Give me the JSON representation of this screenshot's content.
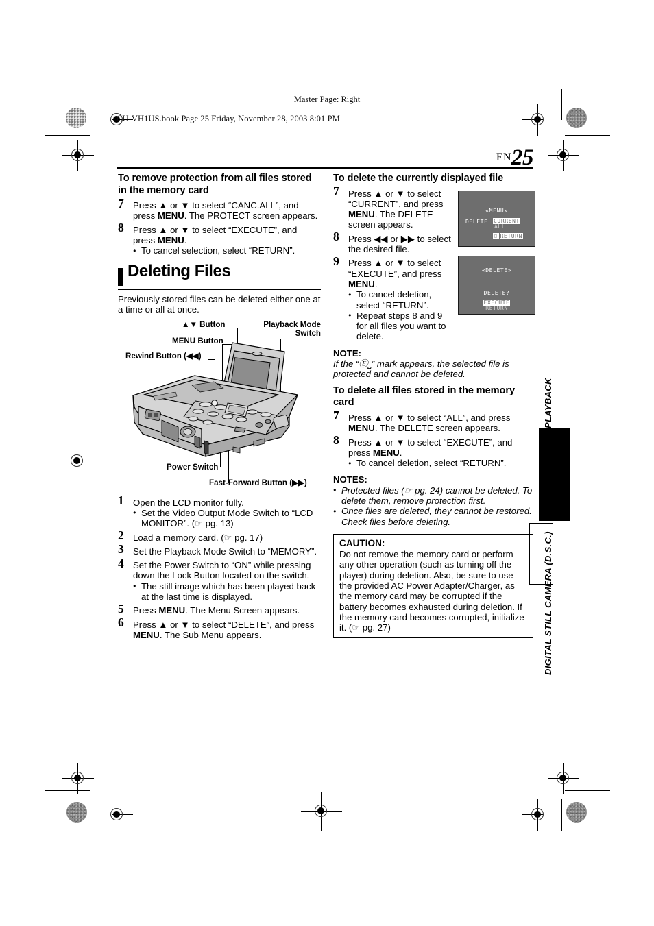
{
  "header": {
    "master_page": "Master Page: Right",
    "book_line": "CU-VH1US.book  Page 25  Friday, November 28, 2003  8:01 PM",
    "lang_code": "EN",
    "page_number": "25"
  },
  "left_column": {
    "section1_heading": "To remove protection from all files stored in the memory card",
    "steps": [
      {
        "number": "7",
        "text_parts": [
          "Press ▲ or ▼ to select “CANC.ALL”, and press ",
          "MENU",
          ". The PROTECT screen appears."
        ]
      },
      {
        "number": "8",
        "text_parts": [
          "Press ▲ or ▼ to select “EXECUTE”, and press ",
          "MENU",
          "."
        ],
        "bullets": [
          "To cancel selection, select “RETURN”."
        ]
      }
    ],
    "banner_title": "Deleting Files",
    "intro": "Previously stored files can be deleted either one at a time or all at once.",
    "callouts": {
      "updown_button": "▲▼ Button",
      "playback_mode_switch": "Playback Mode\nSwitch",
      "menu_button": "MENU Button",
      "rewind_button": "Rewind Button (◀◀)",
      "power_switch": "Power Switch",
      "fast_forward_button": "Fast-Forward Button (▶▶)"
    },
    "numbered_steps": [
      {
        "number": "1",
        "text": "Open the LCD monitor fully.",
        "bullets": [
          "Set the Video Output Mode Switch to “LCD MONITOR”. (☞ pg. 13)"
        ]
      },
      {
        "number": "2",
        "text": "Load a memory card. (☞ pg. 17)"
      },
      {
        "number": "3",
        "text": "Set the Playback Mode Switch to “MEMORY”."
      },
      {
        "number": "4",
        "text": "Set the Power Switch to “ON” while pressing down the Lock Button located on the switch.",
        "bullets": [
          "The still image which has been played back at the last time is displayed."
        ]
      },
      {
        "number": "5",
        "text_parts": [
          "Press ",
          "MENU",
          ". The Menu Screen appears."
        ]
      },
      {
        "number": "6",
        "text_parts": [
          "Press ▲ or ▼ to select “DELETE”, and press ",
          "MENU",
          ". The Sub Menu appears."
        ]
      }
    ]
  },
  "right_column": {
    "section2_heading": "To delete the currently displayed file",
    "steps": [
      {
        "number": "7",
        "text_parts": [
          "Press ▲ or ▼ to select “CURRENT”, and press ",
          "MENU",
          ". The DELETE screen appears."
        ]
      },
      {
        "number": "8",
        "text": "Press ◀◀ or ▶▶ to select the desired file."
      },
      {
        "number": "9",
        "text_parts": [
          "Press ▲ or ▼ to select “EXECUTE”, and press ",
          "MENU",
          "."
        ],
        "bullets": [
          "To cancel deletion, select “RETURN”.",
          "Repeat steps 8 and 9 for all files you want to delete."
        ]
      }
    ],
    "osd_menu": {
      "title": "«MENU»",
      "label": "DELETE",
      "option_selected": "CURRENT",
      "option_other": "ALL",
      "return": "RETURN"
    },
    "osd_delete": {
      "title": "«DELETE»",
      "prompt": "DELETE?",
      "option_selected": "EXECUTE",
      "option_other": "RETURN"
    },
    "note_heading": "NOTE:",
    "note_body": "If the “Ⓔ⎵” mark appears, the selected file is protected and cannot be deleted.",
    "section3_heading": "To delete all files stored in the memory card",
    "steps_all": [
      {
        "number": "7",
        "text_parts": [
          "Press ▲ or ▼ to select “ALL”, and press ",
          "MENU",
          ". The DELETE screen appears."
        ]
      },
      {
        "number": "8",
        "text_parts": [
          "Press ▲ or ▼ to select “EXECUTE”, and press ",
          "MENU",
          "."
        ],
        "bullets": [
          "To cancel deletion, select “RETURN”."
        ]
      }
    ],
    "notes_heading": "NOTES:",
    "notes": [
      "Protected files (☞ pg. 24) cannot be deleted. To delete them, remove protection first.",
      "Once files are deleted, they cannot be restored. Check files before deleting."
    ],
    "caution_heading": "CAUTION:",
    "caution_body": "Do not remove the memory card or perform any other operation (such as turning off the player) during deletion. Also, be sure to use the provided AC Power Adapter/Charger, as the memory card may be corrupted if the battery becomes exhausted during deletion. If the memory card becomes corrupted, initialize it. (☞ pg. 27)"
  },
  "side_tabs": {
    "top": "PLAYBACK",
    "bottom": "DIGITAL STILL CAMERA (D.S.C.)"
  }
}
